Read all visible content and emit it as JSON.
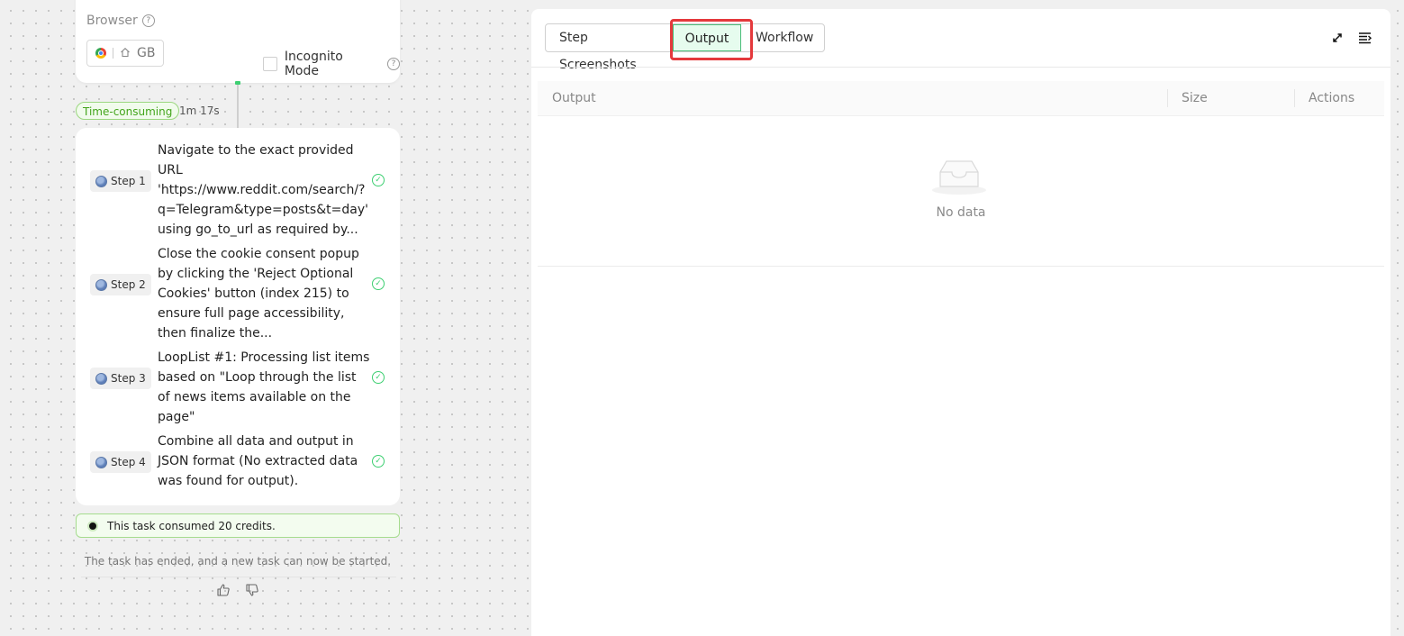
{
  "browser": {
    "title": "Browser",
    "help_icon": "question-icon",
    "region": "GB",
    "incognito_label": "Incognito Mode"
  },
  "timing": {
    "badge": "Time-consuming",
    "duration": "1m 17s"
  },
  "steps": [
    {
      "tag": "Step 1",
      "text": "Navigate to the exact provided URL 'https://www.reddit.com/search/?q=Telegram&type=posts&t=day' using go_to_url as required by...",
      "status": "done"
    },
    {
      "tag": "Step 2",
      "text": "Close the cookie consent popup by clicking the 'Reject Optional Cookies' button (index 215) to ensure full page accessibility, then finalize the...",
      "status": "done"
    },
    {
      "tag": "Step 3",
      "text": "LoopList #1: Processing list items based on \"Loop through the list of news items available on the page\"",
      "status": "done"
    },
    {
      "tag": "Step 4",
      "text": "Combine all data and output in JSON format (No extracted data was found for output).",
      "status": "done"
    }
  ],
  "credits": "This task consumed 20 credits.",
  "ended": "The task has ended, and a new task can now be started.",
  "tabs": [
    {
      "label": "Step Screenshots",
      "active": false
    },
    {
      "label": "Output",
      "active": true
    },
    {
      "label": "Workflow",
      "active": false
    }
  ],
  "table": {
    "columns": [
      "Output",
      "Size",
      "Actions"
    ],
    "empty_text": "No data"
  },
  "colors": {
    "accent_green": "#3ecf72",
    "highlight_red": "#e4393c",
    "active_tab_bg": "#e6fcee"
  }
}
